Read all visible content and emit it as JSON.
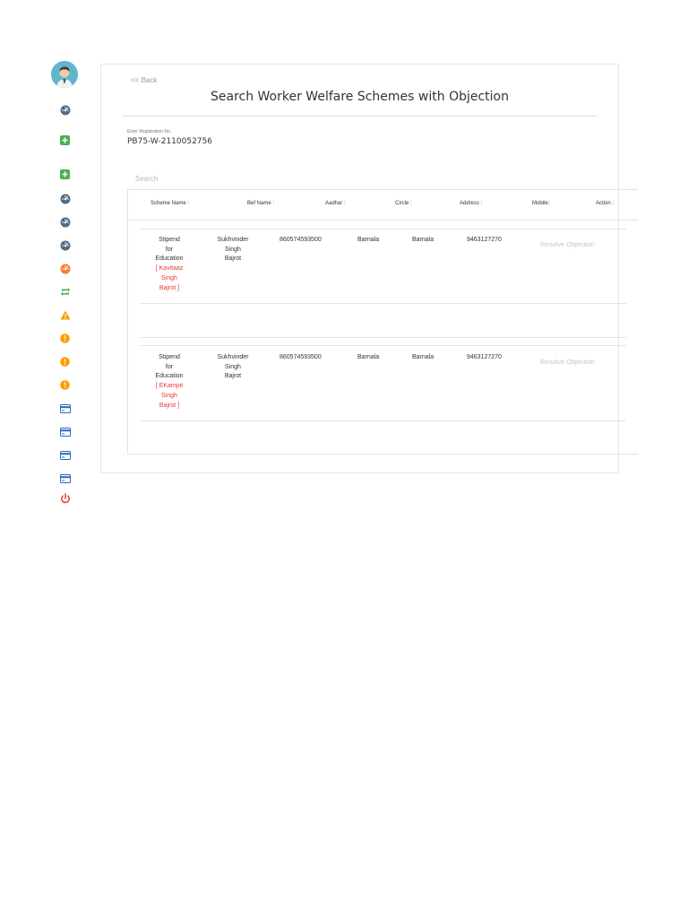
{
  "sidebar": {
    "icons": [
      {
        "name": "dashboard-icon",
        "color": "#4f6b84"
      },
      {
        "name": "add-square-icon",
        "color": "#4caf50"
      },
      {
        "name": "add-square-icon",
        "color": "#4caf50"
      },
      {
        "name": "dashboard-icon",
        "color": "#4f6b84"
      },
      {
        "name": "dashboard-icon",
        "color": "#4f6b84"
      },
      {
        "name": "dashboard-icon",
        "color": "#4f6b84"
      },
      {
        "name": "dashboard-icon",
        "color": "#ff7a2f"
      },
      {
        "name": "retweet-icon",
        "color": "#3fae50"
      },
      {
        "name": "warning-icon",
        "color": "#f4a000"
      },
      {
        "name": "alert-circle-icon",
        "color": "#ff9f00"
      },
      {
        "name": "alert-circle-icon",
        "color": "#ff9f00"
      },
      {
        "name": "alert-circle-icon",
        "color": "#ff9f00"
      },
      {
        "name": "credit-card-icon",
        "color": "#2a67c2"
      },
      {
        "name": "credit-card-icon",
        "color": "#2a67c2"
      },
      {
        "name": "credit-card-icon",
        "color": "#2a67c2"
      },
      {
        "name": "credit-card-icon",
        "color": "#2a67c2"
      },
      {
        "name": "power-icon",
        "color": "#e53935"
      }
    ]
  },
  "page": {
    "back_label": "<< Back",
    "title": "Search Worker Welfare Schemes with Objection",
    "registration_label": "Enter Registration No.",
    "registration_value": "PB75-W-2110052756",
    "search_placeholder": "Search"
  },
  "table": {
    "headers": [
      "Scheme Name :",
      "Bef Name :",
      "Aadhar :",
      "Circle :",
      "Address :",
      "Mobile:",
      "Action :"
    ],
    "rows": [
      {
        "scheme": [
          "Stipend",
          "for",
          "Education"
        ],
        "beneficiary": [
          "[ Kavitaaz",
          "Singh",
          "Bajrot ]"
        ],
        "bef_name": [
          "Sukhvinder",
          "Singh",
          "Bajrot"
        ],
        "aadhar": "860574593500",
        "circle": "Barnala",
        "address": "Barnala",
        "mobile": "9463127270",
        "action": "Resolve Objection"
      },
      {
        "scheme": [
          "Stipend",
          "for",
          "Education"
        ],
        "beneficiary": [
          "[ EKamjot",
          "Singh",
          "Bajrot ]"
        ],
        "bef_name": [
          "Sukhvinder",
          "Singh",
          "Bajrot"
        ],
        "aadhar": "860574593500",
        "circle": "Barnala",
        "address": "Barnala",
        "mobile": "9463127270",
        "action": "Resolve Objection"
      }
    ]
  }
}
